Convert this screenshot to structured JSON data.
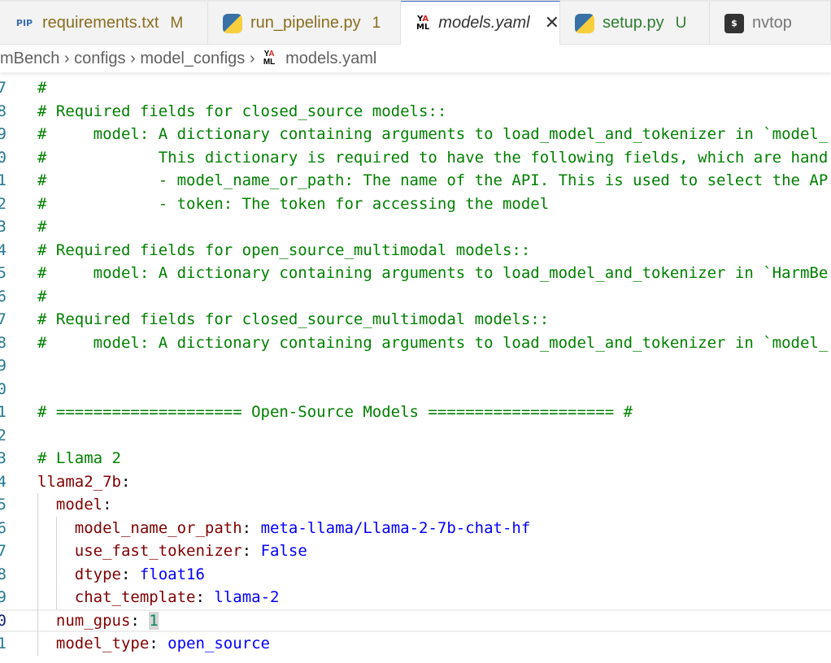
{
  "tabs": [
    {
      "label": "requirements.txt",
      "badge": "M",
      "icon": "pip-icon",
      "color": "#8a6d1f"
    },
    {
      "label": "run_pipeline.py",
      "badge": "1",
      "icon": "python-icon",
      "color": "#8a6d1f"
    },
    {
      "label": "models.yaml",
      "badge": "",
      "icon": "yaml-icon",
      "color": "#333333",
      "active": true
    },
    {
      "label": "setup.py",
      "badge": "U",
      "icon": "python-icon",
      "color": "#2e7d32"
    },
    {
      "label": "nvtop",
      "badge": "",
      "icon": "shell-icon",
      "color": "#777777"
    }
  ],
  "breadcrumb": [
    "mBench",
    "configs",
    "model_configs",
    "models.yaml"
  ],
  "lines": [
    {
      "n": "7",
      "t": [
        [
          "c",
          "#"
        ]
      ]
    },
    {
      "n": "8",
      "t": [
        [
          "c",
          "# Required fields for closed_source models::"
        ]
      ]
    },
    {
      "n": "9",
      "t": [
        [
          "c",
          "#     model: A dictionary containing arguments to load_model_and_tokenizer in `model_"
        ]
      ]
    },
    {
      "n": "0",
      "t": [
        [
          "c",
          "#            This dictionary is required to have the following fields, which are hand"
        ]
      ]
    },
    {
      "n": "1",
      "t": [
        [
          "c",
          "#            - model_name_or_path: The name of the API. This is used to select the AP"
        ]
      ]
    },
    {
      "n": "2",
      "t": [
        [
          "c",
          "#            - token: The token for accessing the model"
        ]
      ]
    },
    {
      "n": "3",
      "t": [
        [
          "c",
          "#"
        ]
      ]
    },
    {
      "n": "4",
      "t": [
        [
          "c",
          "# Required fields for open_source_multimodal models::"
        ]
      ]
    },
    {
      "n": "5",
      "t": [
        [
          "c",
          "#     model: A dictionary containing arguments to load_model_and_tokenizer in `HarmBe"
        ]
      ]
    },
    {
      "n": "6",
      "t": [
        [
          "c",
          "#"
        ]
      ]
    },
    {
      "n": "7",
      "t": [
        [
          "c",
          "# Required fields for closed_source_multimodal models::"
        ]
      ]
    },
    {
      "n": "8",
      "t": [
        [
          "c",
          "#     model: A dictionary containing arguments to load_model_and_tokenizer in `model_"
        ]
      ]
    },
    {
      "n": "9",
      "t": []
    },
    {
      "n": "0",
      "t": []
    },
    {
      "n": "1",
      "t": [
        [
          "c",
          "# ==================== Open-Source Models ==================== #"
        ]
      ]
    },
    {
      "n": "2",
      "t": []
    },
    {
      "n": "3",
      "t": [
        [
          "c",
          "# Llama 2"
        ]
      ]
    },
    {
      "n": "4",
      "t": [
        [
          "k",
          "llama2_7b"
        ],
        [
          "p",
          ":"
        ]
      ]
    },
    {
      "n": "5",
      "t": [
        [
          "p",
          "  "
        ],
        [
          "k",
          "model"
        ],
        [
          "p",
          ":"
        ]
      ]
    },
    {
      "n": "6",
      "t": [
        [
          "p",
          "    "
        ],
        [
          "k",
          "model_name_or_path"
        ],
        [
          "p",
          ": "
        ],
        [
          "v",
          "meta-llama/Llama-2-7b-chat-hf"
        ]
      ]
    },
    {
      "n": "7",
      "t": [
        [
          "p",
          "    "
        ],
        [
          "k",
          "use_fast_tokenizer"
        ],
        [
          "p",
          ": "
        ],
        [
          "v",
          "False"
        ]
      ]
    },
    {
      "n": "8",
      "t": [
        [
          "p",
          "    "
        ],
        [
          "k",
          "dtype"
        ],
        [
          "p",
          ": "
        ],
        [
          "v",
          "float16"
        ]
      ]
    },
    {
      "n": "9",
      "t": [
        [
          "p",
          "    "
        ],
        [
          "k",
          "chat_template"
        ],
        [
          "p",
          ": "
        ],
        [
          "v",
          "llama-2"
        ]
      ]
    },
    {
      "n": "0",
      "t": [
        [
          "p",
          "  "
        ],
        [
          "k",
          "num_gpus"
        ],
        [
          "p",
          ": "
        ],
        [
          "n",
          "1"
        ]
      ],
      "current": true
    },
    {
      "n": "1",
      "t": [
        [
          "p",
          "  "
        ],
        [
          "k",
          "model_type"
        ],
        [
          "p",
          ": "
        ],
        [
          "v",
          "open_source"
        ]
      ]
    }
  ]
}
